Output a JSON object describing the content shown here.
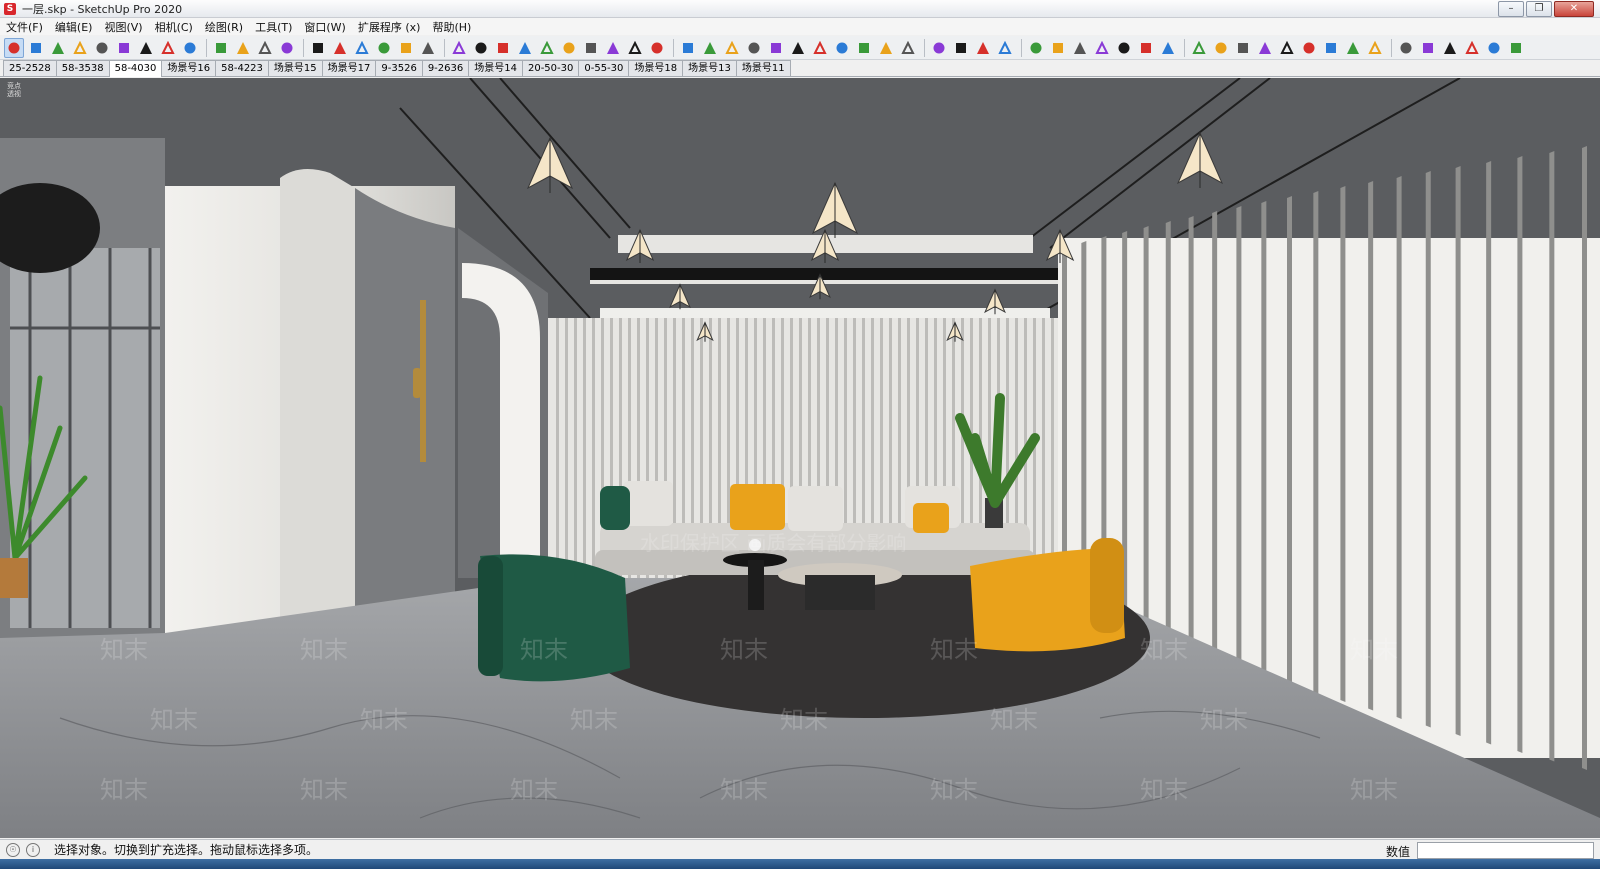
{
  "window": {
    "title": "一层.skp - SketchUp Pro 2020",
    "app_icon": "sketchup-logo-icon",
    "buttons": [
      "minimize",
      "maximize",
      "close"
    ]
  },
  "menu": [
    {
      "label": "文件(F)"
    },
    {
      "label": "编辑(E)"
    },
    {
      "label": "视图(V)"
    },
    {
      "label": "相机(C)"
    },
    {
      "label": "绘图(R)"
    },
    {
      "label": "工具(T)"
    },
    {
      "label": "窗口(W)"
    },
    {
      "label": "扩展程序 (x)"
    },
    {
      "label": "帮助(H)"
    }
  ],
  "toolbar": {
    "active_tool": "orbit",
    "groups": [
      [
        "orbit-icon",
        "pan-icon",
        "zoom-icon",
        "zoom-window-icon",
        "zoom-extents-icon",
        "previous-view-icon",
        "walk-icon",
        "look-around-icon",
        "position-camera-icon"
      ],
      [
        "select-icon",
        "iso-view-icon",
        "perspective-icon",
        "two-point-icon"
      ],
      [
        "xray-icon",
        "back-edges-icon",
        "wireframe-icon",
        "hidden-line-icon",
        "shaded-icon",
        "textured-icon"
      ],
      [
        "section-plane-icon",
        "refresh-icon",
        "layers-icon",
        "add-icon",
        "tree-icon",
        "checker-icon",
        "cloud-icon",
        "gear-icon",
        "mail-icon",
        "info-icon"
      ],
      [
        "outliner-icon",
        "bulb-icon",
        "contrast-icon",
        "monitor-icon",
        "expand-icon",
        "hexagon-icon",
        "hexagon-outline-icon",
        "target-icon",
        "grid-icon",
        "erase-icon",
        "cart-icon"
      ],
      [
        "import-icon",
        "layers-stack-icon",
        "render-icon",
        "settings-cog-icon"
      ],
      [
        "door-icon",
        "window-icon",
        "frame-icon",
        "tile-icon",
        "railing-icon",
        "stairs-icon",
        "tag-icon"
      ],
      [
        "check-icon",
        "check-arrow-icon",
        "checklist-icon",
        "scissors-icon",
        "copy-icon",
        "scale-icon",
        "bars-icon",
        "curve-icon",
        "resize-icon"
      ],
      [
        "text-icon",
        "pyramid-icon",
        "stamp-icon",
        "arch-icon",
        "flame-icon",
        "extension-icon"
      ]
    ]
  },
  "scene_tabs": [
    {
      "label": "25-2528"
    },
    {
      "label": "58-3538"
    },
    {
      "label": "58-4030",
      "active": true
    },
    {
      "label": "场景号16"
    },
    {
      "label": "58-4223"
    },
    {
      "label": "场景号15"
    },
    {
      "label": "场景号17"
    },
    {
      "label": "9-3526"
    },
    {
      "label": "9-2636"
    },
    {
      "label": "场景号14"
    },
    {
      "label": "20-50-30"
    },
    {
      "label": "0-55-30"
    },
    {
      "label": "场景号18"
    },
    {
      "label": "场景号13"
    },
    {
      "label": "场景号11"
    }
  ],
  "viewport": {
    "corner_label_1": "竞点",
    "corner_label_2": "透视",
    "watermark_banner": "水印保护区 画质会有部分影响",
    "watermark_text": "知末"
  },
  "status": {
    "message": "选择对象。切换到扩充选择。拖动鼠标选择多项。",
    "measurement_label": "数值",
    "measurement_value": ""
  },
  "colors": {
    "ceiling": "#5b5d60",
    "wall_light": "#e9e8e5",
    "floor": "#8f9194",
    "rug": "#343232",
    "sofa": "#d6d4d0",
    "accent_orange": "#e9a21b",
    "accent_green": "#1f5a45",
    "active_tab": "#ffffff",
    "tool_active": "#c6dcf5"
  }
}
